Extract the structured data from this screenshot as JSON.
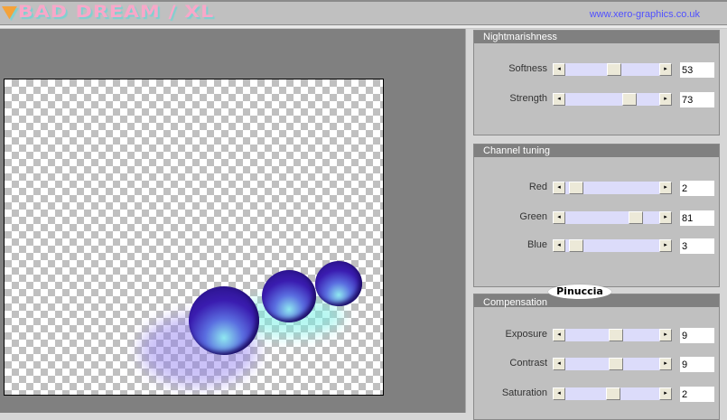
{
  "app": {
    "title_prefix": "▼",
    "title": "BAD DREAM / XL",
    "url": "www.xero-graphics.co.uk"
  },
  "watermark": "Pinuccia",
  "sections": [
    {
      "title": "Nightmarishness",
      "controls": [
        {
          "label": "Softness",
          "value": "53"
        },
        {
          "label": "Strength",
          "value": "73"
        }
      ]
    },
    {
      "title": "Channel tuning",
      "controls": [
        {
          "label": "Red",
          "value": "2"
        },
        {
          "label": "Green",
          "value": "81"
        },
        {
          "label": "Blue",
          "value": "3"
        }
      ]
    },
    {
      "title": "Compensation",
      "controls": [
        {
          "label": "Exposure",
          "value": "9"
        },
        {
          "label": "Contrast",
          "value": "9"
        },
        {
          "label": "Saturation",
          "value": "2"
        }
      ]
    }
  ],
  "icons": {
    "left": "◂",
    "right": "▸"
  }
}
